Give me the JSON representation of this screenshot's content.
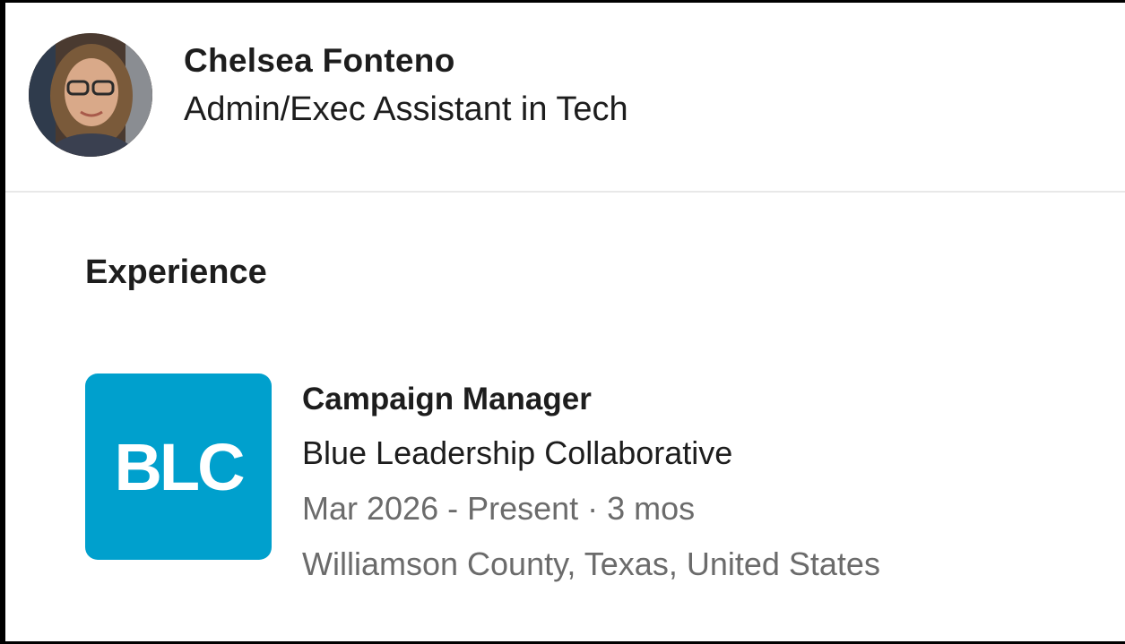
{
  "profile": {
    "name": "Chelsea Fonteno",
    "headline": "Admin/Exec Assistant in Tech"
  },
  "experience": {
    "section_title": "Experience",
    "items": [
      {
        "logo_text": "BLC",
        "logo_color": "#00a0cd",
        "title": "Campaign Manager",
        "company": "Blue Leadership Collaborative",
        "dates": "Mar 2026 - Present · 3 mos",
        "location": "Williamson County, Texas, United States"
      }
    ]
  }
}
